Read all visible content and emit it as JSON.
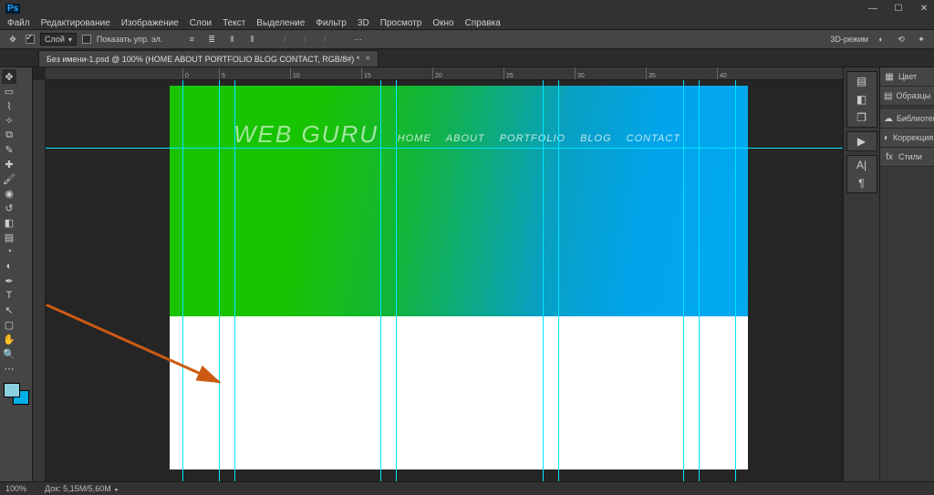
{
  "app": {
    "ps": "Ps"
  },
  "window_controls": {
    "min": "—",
    "max": "☐",
    "close": "✕"
  },
  "menu": [
    "Файл",
    "Редактирование",
    "Изображение",
    "Слои",
    "Текст",
    "Выделение",
    "Фильтр",
    "3D",
    "Просмотр",
    "Окно",
    "Справка"
  ],
  "options": {
    "layer_label": "Слой",
    "show_tc": "Показать упр. эл.",
    "mode_3d": "3D-режим"
  },
  "doc_tab": {
    "title": "Без имени-1.psd @ 100% (HOME ABOUT PORTFOLIO BLOG CONTACT, RGB/8#) *"
  },
  "canvas": {
    "logo": "WEB GURU",
    "nav": [
      "HOME",
      "ABOUT",
      "PORTFOLIO",
      "BLOG",
      "CONTACT"
    ]
  },
  "panels": {
    "color": "Цвет",
    "swatches": "Образцы",
    "libraries": "Библиотеки",
    "adjustments": "Коррекция",
    "styles": "Стили"
  },
  "status": {
    "zoom": "100%",
    "doc": "Док: 5,15M/5,60M"
  },
  "ruler_ticks": [
    "0",
    "5",
    "10",
    "15",
    "20",
    "25",
    "30",
    "35",
    "40"
  ]
}
